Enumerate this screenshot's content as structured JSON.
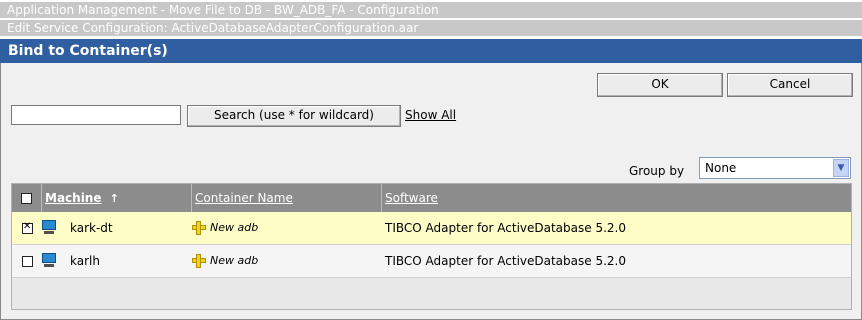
{
  "breadcrumbs": [
    "Application Management - Move File to DB - BW_ADB_FA - Configuration",
    "Edit Service Configuration: ActiveDatabaseAdapterConfiguration.aar"
  ],
  "dialog": {
    "title": "Bind to Container(s)",
    "ok_label": "OK",
    "cancel_label": "Cancel",
    "search": {
      "value": "",
      "placeholder": "",
      "button_label": "Search (use * for wildcard)",
      "show_all_label": "Show All"
    },
    "group_by": {
      "label": "Group by",
      "selected": "None"
    },
    "table": {
      "columns": [
        {
          "label": "Machine",
          "sort_indicator": "↑"
        },
        {
          "label": "Container Name"
        },
        {
          "label": "Software"
        }
      ],
      "rows": [
        {
          "checked": true,
          "machine": "kark-dt",
          "container_name": "New adb",
          "software": "TIBCO Adapter for ActiveDatabase 5.2.0"
        },
        {
          "checked": false,
          "machine": "karlh",
          "container_name": "New adb",
          "software": "TIBCO Adapter for ActiveDatabase 5.2.0"
        }
      ]
    }
  },
  "colors": {
    "title_bar": "#2f5fa0",
    "header_bar": "#8c8c8c",
    "selected_row": "#fefdc8"
  },
  "icons": {
    "machine": "monitor-icon",
    "container": "plus-icon",
    "dropdown": "chevron-down-icon"
  }
}
